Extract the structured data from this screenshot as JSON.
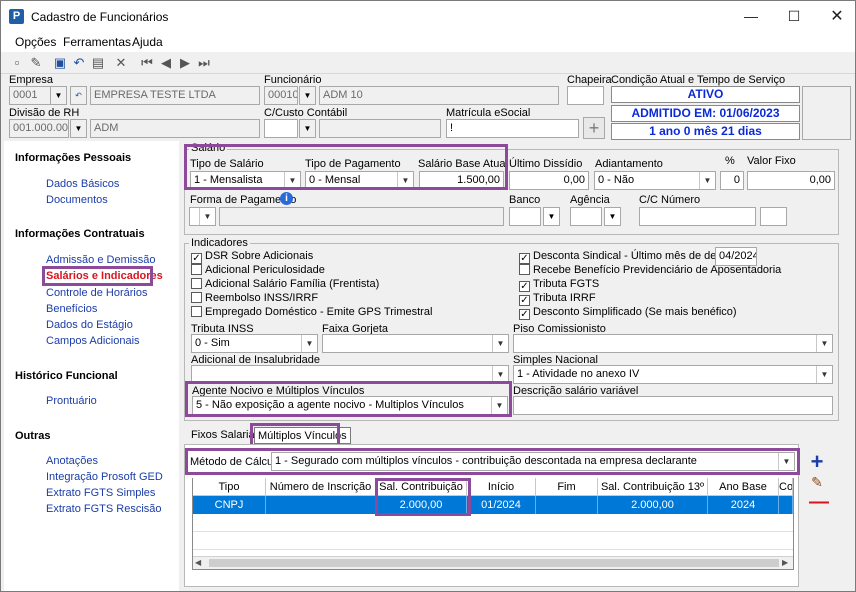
{
  "window": {
    "title": "Cadastro de Funcionários",
    "icon": "app-logo-icon"
  },
  "menu": [
    "Opções",
    "Ferramentas",
    "Ajuda"
  ],
  "header": {
    "empresa_label": "Empresa",
    "empresa_code": "0001",
    "empresa_name": "EMPRESA TESTE LTDA",
    "funcionario_label": "Funcionário",
    "funcionario_code": "00010",
    "funcionario_name": "ADM 10",
    "chapeira_label": "Chapeira",
    "chapeira_value": "",
    "condicao_label": "Condição Atual e Tempo de Serviço",
    "status_ativo": "ATIVO",
    "admitido": "ADMITIDO EM: 01/06/2023",
    "tempo": "1 ano 0 mês 21 dias",
    "divisao_label": "Divisão de RH",
    "divisao_code": "001.000.000",
    "divisao_name": "ADM",
    "ccusto_label": "C/Custo Contábil",
    "matricula_label": "Matrícula eSocial",
    "matricula_value": "!"
  },
  "sidebar": {
    "sections": [
      {
        "title": "Informações Pessoais",
        "items": [
          "Dados Básicos",
          "Documentos"
        ]
      },
      {
        "title": "Informações Contratuais",
        "items": [
          "Admissão e Demissão",
          "Salários e Indicadores",
          "Controle de Horários",
          "Benefícios",
          "Dados do Estágio",
          "Campos Adicionais"
        ]
      },
      {
        "title": "Histórico Funcional",
        "items": [
          "Prontuário"
        ]
      },
      {
        "title": "Outras",
        "items": [
          "Anotações",
          "Integração Prosoft GED",
          "Extrato FGTS Simples",
          "Extrato FGTS Rescisão"
        ]
      }
    ],
    "active": "Salários e Indicadores"
  },
  "salario": {
    "group_title": "Salário",
    "tipo_salario_label": "Tipo de Salário",
    "tipo_salario_value": "1 - Mensalista",
    "tipo_pagamento_label": "Tipo de Pagamento",
    "tipo_pagamento_value": "0 - Mensal",
    "salario_base_label": "Salário Base Atual",
    "salario_base_value": "1.500,00",
    "ultimo_dissidio_label": "Último Dissídio",
    "ultimo_dissidio_value": "0,00",
    "adiantamento_label": "Adiantamento",
    "adiantamento_value": "0 - Não",
    "pct_label": "%",
    "pct_value": "0",
    "valor_fixo_label": "Valor Fixo",
    "valor_fixo_value": "0,00",
    "forma_pagamento_label": "Forma de Pagamento",
    "banco_label": "Banco",
    "agencia_label": "Agência",
    "cc_label": "C/C Número"
  },
  "indicadores": {
    "group_title": "Indicadores",
    "left_checks": [
      {
        "label": "DSR Sobre Adicionais",
        "checked": true
      },
      {
        "label": "Adicional Periculosidade",
        "checked": false
      },
      {
        "label": "Adicional Salário Família (Frentista)",
        "checked": false
      },
      {
        "label": "Reembolso INSS/IRRF",
        "checked": false
      },
      {
        "label": "Empregado Doméstico - Emite GPS Trimestral",
        "checked": false
      }
    ],
    "right_checks": [
      {
        "label": "Desconta Sindical - Último mês de desconto",
        "checked": true
      },
      {
        "label": "Recebe Benefício Previdenciário de Aposentadoria",
        "checked": false
      },
      {
        "label": "Tributa FGTS",
        "checked": true
      },
      {
        "label": "Tributa IRRF",
        "checked": true
      },
      {
        "label": "Desconto Simplificado (Se mais benéfico)",
        "checked": true
      }
    ],
    "ultimo_mes_desconto": "04/2024",
    "tributa_inss_label": "Tributa INSS",
    "tributa_inss_value": "0 - Sim",
    "faixa_gorjeta_label": "Faixa Gorjeta",
    "piso_label": "Piso Comissionisto",
    "insalubridade_label": "Adicional de Insalubridade",
    "simples_label": "Simples Nacional",
    "simples_value": "1 - Atividade no anexo IV",
    "agente_label": "Agente Nocivo e  Múltiplos Vínculos",
    "agente_value": "5 - Não exposição a agente nocivo - Multiplos Vínculos",
    "descricao_label": "Descrição salário variável"
  },
  "tabs": [
    "Fixos Salariais",
    "Múltiplos Vínculos"
  ],
  "vinculos": {
    "metodo_label": "Método de Cálculo",
    "metodo_value": "1 - Segurado com múltiplos vínculos - contribuição descontada na empresa declarante",
    "columns": [
      "Tipo",
      "Número de Inscrição",
      "Sal. Contribuição",
      "Início",
      "Fim",
      "Sal. Contribuição 13º",
      "Ano Base",
      "Co"
    ],
    "rows": [
      [
        "CNPJ",
        "",
        "2.000,00",
        "01/2024",
        "",
        "2.000,00",
        "2024",
        ""
      ]
    ]
  }
}
